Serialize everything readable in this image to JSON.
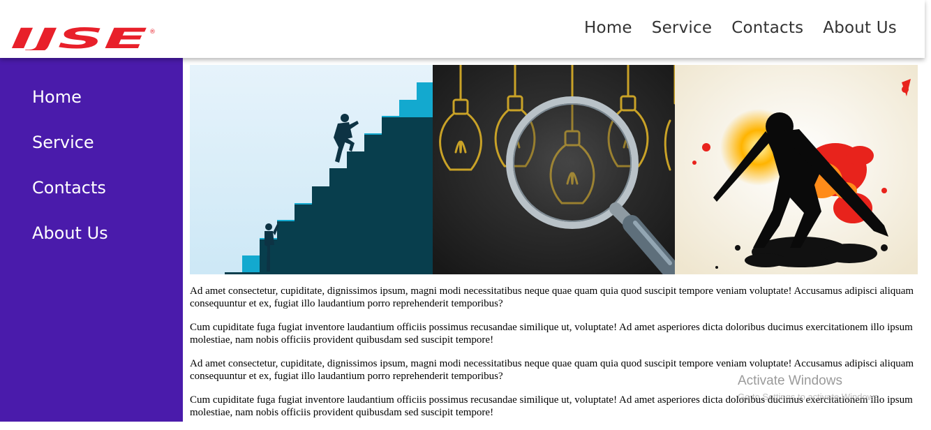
{
  "brand": {
    "logo_text": "IJSE",
    "logo_mark": "®",
    "color": "#e8202a"
  },
  "top_nav": [
    {
      "label": "Home"
    },
    {
      "label": "Service"
    },
    {
      "label": "Contacts"
    },
    {
      "label": "About Us"
    }
  ],
  "sidebar": {
    "background": "#4a1bab",
    "items": [
      {
        "label": "Home"
      },
      {
        "label": "Service"
      },
      {
        "label": "Contacts"
      },
      {
        "label": "About Us"
      }
    ]
  },
  "banner": {
    "images": [
      {
        "icon": "stairs-climbing-illustration"
      },
      {
        "icon": "lightbulbs-magnifier-illustration"
      },
      {
        "icon": "cricket-batsman-splash-illustration"
      }
    ]
  },
  "content": {
    "paragraphs": [
      "Ad amet consectetur, cupiditate, dignissimos ipsum, magni modi necessitatibus neque quae quam quia quod suscipit tempore veniam voluptate! Accusamus adipisci aliquam consequuntur et ex, fugiat illo laudantium porro reprehenderit temporibus?",
      "Cum cupiditate fuga fugiat inventore laudantium officiis possimus recusandae similique ut, voluptate! Ad amet asperiores dicta doloribus ducimus exercitationem illo ipsum molestiae, nam nobis officiis provident quibusdam sed suscipit tempore!",
      "Ad amet consectetur, cupiditate, dignissimos ipsum, magni modi necessitatibus neque quae quam quia quod suscipit tempore veniam voluptate! Accusamus adipisci aliquam consequuntur et ex, fugiat illo laudantium porro reprehenderit temporibus?",
      "Cum cupiditate fuga fugiat inventore laudantium officiis possimus recusandae similique ut, voluptate! Ad amet asperiores dicta doloribus ducimus exercitationem illo ipsum molestiae, nam nobis officiis provident quibusdam sed suscipit tempore!"
    ]
  },
  "watermark": {
    "title": "Activate Windows",
    "subtitle": "Go to Settings to activate Windows."
  }
}
